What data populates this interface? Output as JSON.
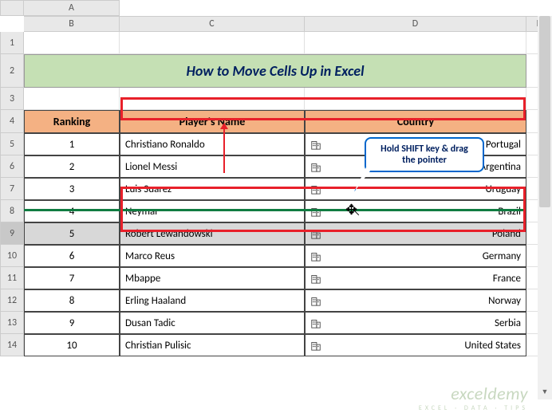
{
  "columns": [
    "",
    "A",
    "B",
    "C",
    "D",
    "E"
  ],
  "title": "How to Move Cells Up in Excel",
  "headers": {
    "ranking": "Ranking",
    "player": "Player's Name",
    "country": "Country"
  },
  "rows": [
    {
      "rank": "1",
      "player": "Christiano Ronaldo",
      "country": "Portugal"
    },
    {
      "rank": "2",
      "player": "Lionel Messi",
      "country": "Argentina"
    },
    {
      "rank": "3",
      "player": "Luis Suarez",
      "country": "Uruguay"
    },
    {
      "rank": "4",
      "player": "Neymar",
      "country": "Brazil"
    },
    {
      "rank": "5",
      "player": "Robert Lewandowski",
      "country": "Poland"
    },
    {
      "rank": "6",
      "player": "Marco Reus",
      "country": "Germany"
    },
    {
      "rank": "7",
      "player": "Mbappe",
      "country": "France"
    },
    {
      "rank": "8",
      "player": "Erling Haaland",
      "country": "Norway"
    },
    {
      "rank": "9",
      "player": "Dusan Tadic",
      "country": "Serbia"
    },
    {
      "rank": "10",
      "player": "Christian Pulisic",
      "country": "United States"
    }
  ],
  "callout": "Hold SHIFT key & drag the pointer",
  "watermark": {
    "main": "exceldemy",
    "sub": "EXCEL · DATA · TIPS"
  },
  "chart_data": {
    "type": "table",
    "title": "How to Move Cells Up in Excel",
    "columns": [
      "Ranking",
      "Player's Name",
      "Country"
    ],
    "rows": [
      [
        1,
        "Christiano Ronaldo",
        "Portugal"
      ],
      [
        2,
        "Lionel Messi",
        "Argentina"
      ],
      [
        3,
        "Luis Suarez",
        "Uruguay"
      ],
      [
        4,
        "Neymar",
        "Brazil"
      ],
      [
        5,
        "Robert Lewandowski",
        "Poland"
      ],
      [
        6,
        "Marco Reus",
        "Germany"
      ],
      [
        7,
        "Mbappe",
        "France"
      ],
      [
        8,
        "Erling Haaland",
        "Norway"
      ],
      [
        9,
        "Dusan Tadic",
        "Serbia"
      ],
      [
        10,
        "Christian Pulisic",
        "United States"
      ]
    ]
  }
}
